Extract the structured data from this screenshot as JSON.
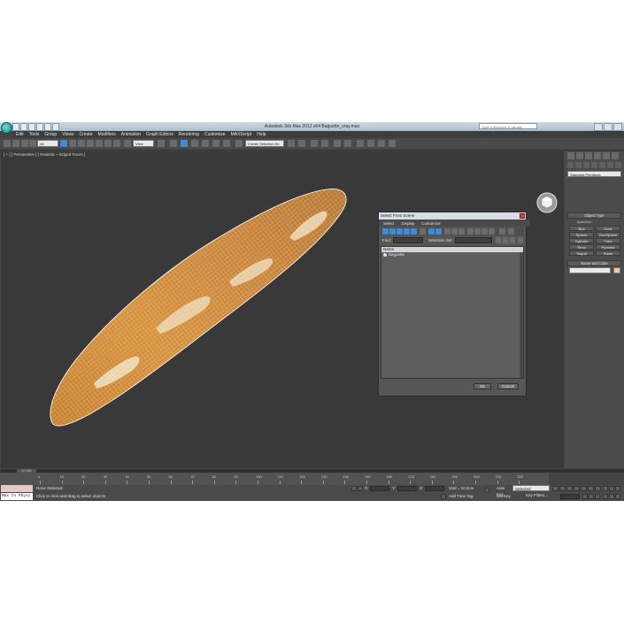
{
  "window": {
    "title": "Autodesk 3ds Max 2012 x64      Baguette_vray.max",
    "search_placeholder": "Type a keyword or phrase"
  },
  "menu": [
    "Edit",
    "Tools",
    "Group",
    "Views",
    "Create",
    "Modifiers",
    "Animation",
    "Graph Editors",
    "Rendering",
    "Customize",
    "MAXScript",
    "Help"
  ],
  "toolbar": {
    "filter_value": "All",
    "refcoord_value": "View",
    "selection_set_value": "Create Selection Se"
  },
  "viewport": {
    "label": "[ + ] [ Perspective ] [ Realistic + Edged Faces ]"
  },
  "command_panel": {
    "category": "Standard Primitives",
    "object_type_header": "Object Type",
    "autogrid_label": "AutoGrid",
    "objects": [
      "Box",
      "Cone",
      "Sphere",
      "GeoSphere",
      "Cylinder",
      "Tube",
      "Torus",
      "Pyramid",
      "Teapot",
      "Plane"
    ],
    "name_color_header": "Name and Color",
    "object_color": "#efc7a1"
  },
  "dialog": {
    "title": "Select From Scene",
    "menu": [
      "Select",
      "Display",
      "Customize"
    ],
    "find_label": "Find:",
    "selection_set_label": "Selection Set:",
    "column_header": "Name",
    "rows": [
      "Baguette"
    ],
    "ok_label": "OK",
    "cancel_label": "Cancel"
  },
  "timeline": {
    "frame_label": "0 / 100",
    "ticks": [
      "0",
      "10",
      "20",
      "30",
      "40",
      "50",
      "60",
      "70",
      "80",
      "90",
      "100",
      "110",
      "120",
      "130",
      "140",
      "150",
      "160",
      "170",
      "180",
      "190",
      "200",
      "210",
      "220"
    ]
  },
  "status": {
    "maxscript_text": "Max to Physc",
    "selection_text": "None Selected",
    "prompt_text": "Click or click-and-drag to select objects",
    "x_label": "X:",
    "y_label": "Y:",
    "z_label": "Z:",
    "grid_text": "Grid = 10,0cm",
    "add_time_tag": "Add Time Tag",
    "auto_key": "Auto Key",
    "selected_value": "Selected",
    "set_key": "Set Key",
    "key_filters": "Key Filters..."
  }
}
